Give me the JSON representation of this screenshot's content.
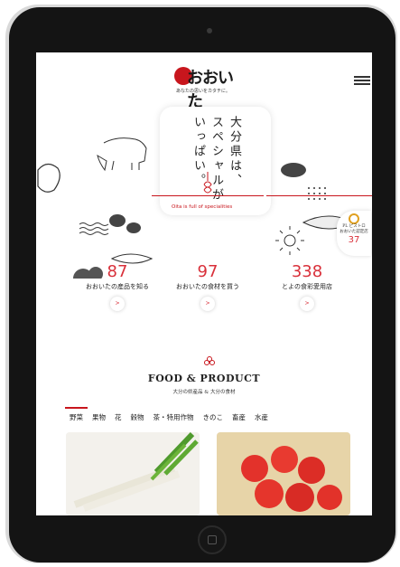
{
  "header": {
    "logo_text": "おおいた",
    "logo_tagline": "あなたの思いをカタチに。",
    "menu_icon": "hamburger-menu-icon"
  },
  "hero": {
    "vertical_lines": [
      "大分県は、",
      "スペシャルが",
      "いっぱい。"
    ],
    "caption": "Oita is full of specialities"
  },
  "stats": [
    {
      "value": "87",
      "label": "おおいたの産品を知る",
      "button": ">"
    },
    {
      "value": "97",
      "label": "おおいたの食材を買う",
      "button": ">"
    },
    {
      "value": "338",
      "label": "とよの食彩愛用店",
      "button": ">"
    }
  ],
  "badge": {
    "line1": "PL ピストロ",
    "line2": "おおいた認定店",
    "value": "37"
  },
  "food_product": {
    "title": "FOOD & PRODUCT",
    "subtitle": "大分の県産品 & 大分の食材"
  },
  "tabs": [
    "野菜",
    "果物",
    "花",
    "穀物",
    "茶・特用作物",
    "きのこ",
    "畜産",
    "水産"
  ],
  "active_tab": 0,
  "colors": {
    "accent": "#c8161d",
    "stat_red": "#d9303a"
  }
}
